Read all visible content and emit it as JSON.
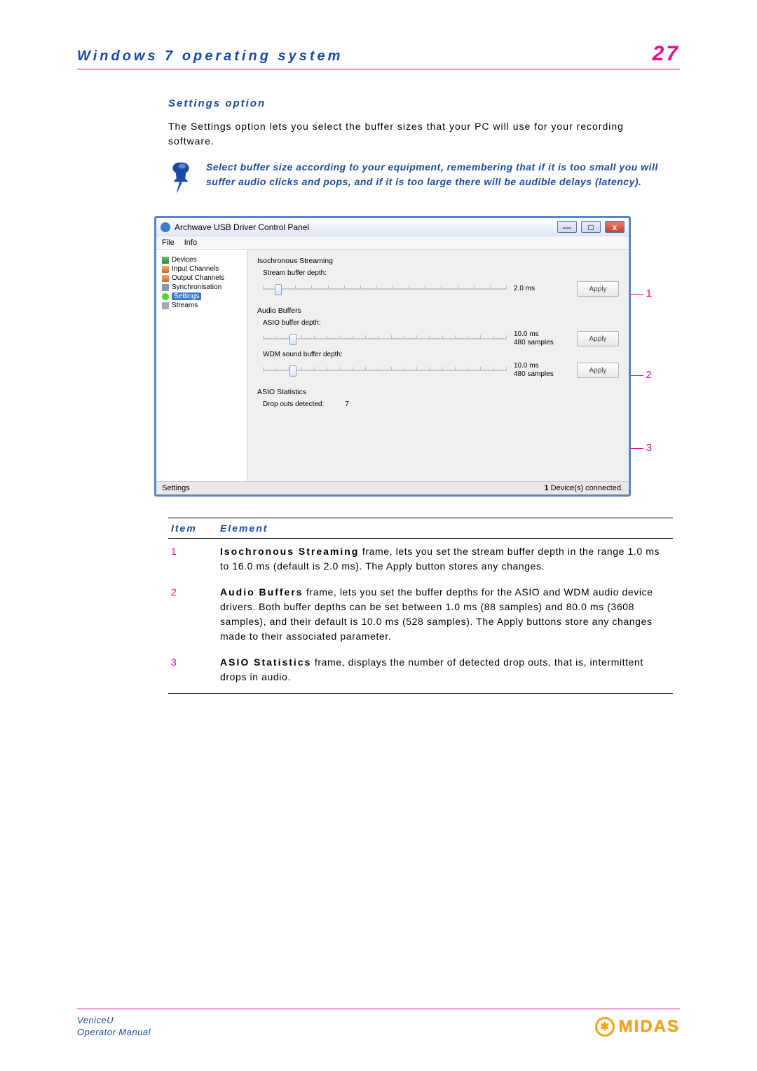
{
  "header": {
    "title": "Windows 7 operating system",
    "page_number": "27"
  },
  "section": {
    "heading": "Settings option",
    "intro": "The Settings option lets you select the buffer sizes that your PC will use for your recording software.",
    "note": "Select buffer size according to your equipment, remembering that if it is too small you will suffer audio clicks and pops, and if it is too large there will be audible delays (latency)."
  },
  "window": {
    "title": "Archwave USB Driver Control Panel",
    "menu": {
      "file": "File",
      "info": "Info"
    },
    "tree": {
      "devices": "Devices",
      "input_channels": "Input Channels",
      "output_channels": "Output Channels",
      "synchronisation": "Synchronisation",
      "settings": "Settings",
      "streams": "Streams"
    },
    "iso": {
      "title": "Isochronous Streaming",
      "stream_label": "Stream buffer depth:",
      "stream_value": "2.0 ms",
      "apply": "Apply"
    },
    "audio": {
      "title": "Audio Buffers",
      "asio_label": "ASIO buffer depth:",
      "asio_value_ms": "10.0 ms",
      "asio_value_samples": "480 samples",
      "wdm_label": "WDM sound buffer depth:",
      "wdm_value_ms": "10.0 ms",
      "wdm_value_samples": "480 samples",
      "apply": "Apply"
    },
    "stats": {
      "title": "ASIO Statistics",
      "drop_label": "Drop outs detected:",
      "drop_value": "7"
    },
    "status": {
      "left": "Settings",
      "right_count": "1",
      "right_text": " Device(s) connected."
    }
  },
  "callouts": {
    "c1": "1",
    "c2": "2",
    "c3": "3"
  },
  "table": {
    "head_item": "Item",
    "head_element": "Element",
    "rows": [
      {
        "num": "1",
        "bold": "Isochronous Streaming",
        "text": " frame, lets you set the stream buffer depth in the range 1.0 ms to 16.0 ms (default is 2.0 ms).  The Apply button stores any changes."
      },
      {
        "num": "2",
        "bold": "Audio Buffers",
        "text": " frame, lets you set the buffer depths for the ASIO and WDM audio device drivers.  Both buffer depths can be set between 1.0 ms (88 samples) and 80.0 ms (3608 samples), and their default is 10.0 ms (528 samples).  The Apply buttons store any changes made to their associated parameter."
      },
      {
        "num": "3",
        "bold": "ASIO Statistics",
        "text": " frame, displays the number of detected drop outs, that is, intermittent drops in audio."
      }
    ]
  },
  "footer": {
    "product": "VeniceU",
    "manual": "Operator Manual",
    "brand": "MIDAS"
  }
}
